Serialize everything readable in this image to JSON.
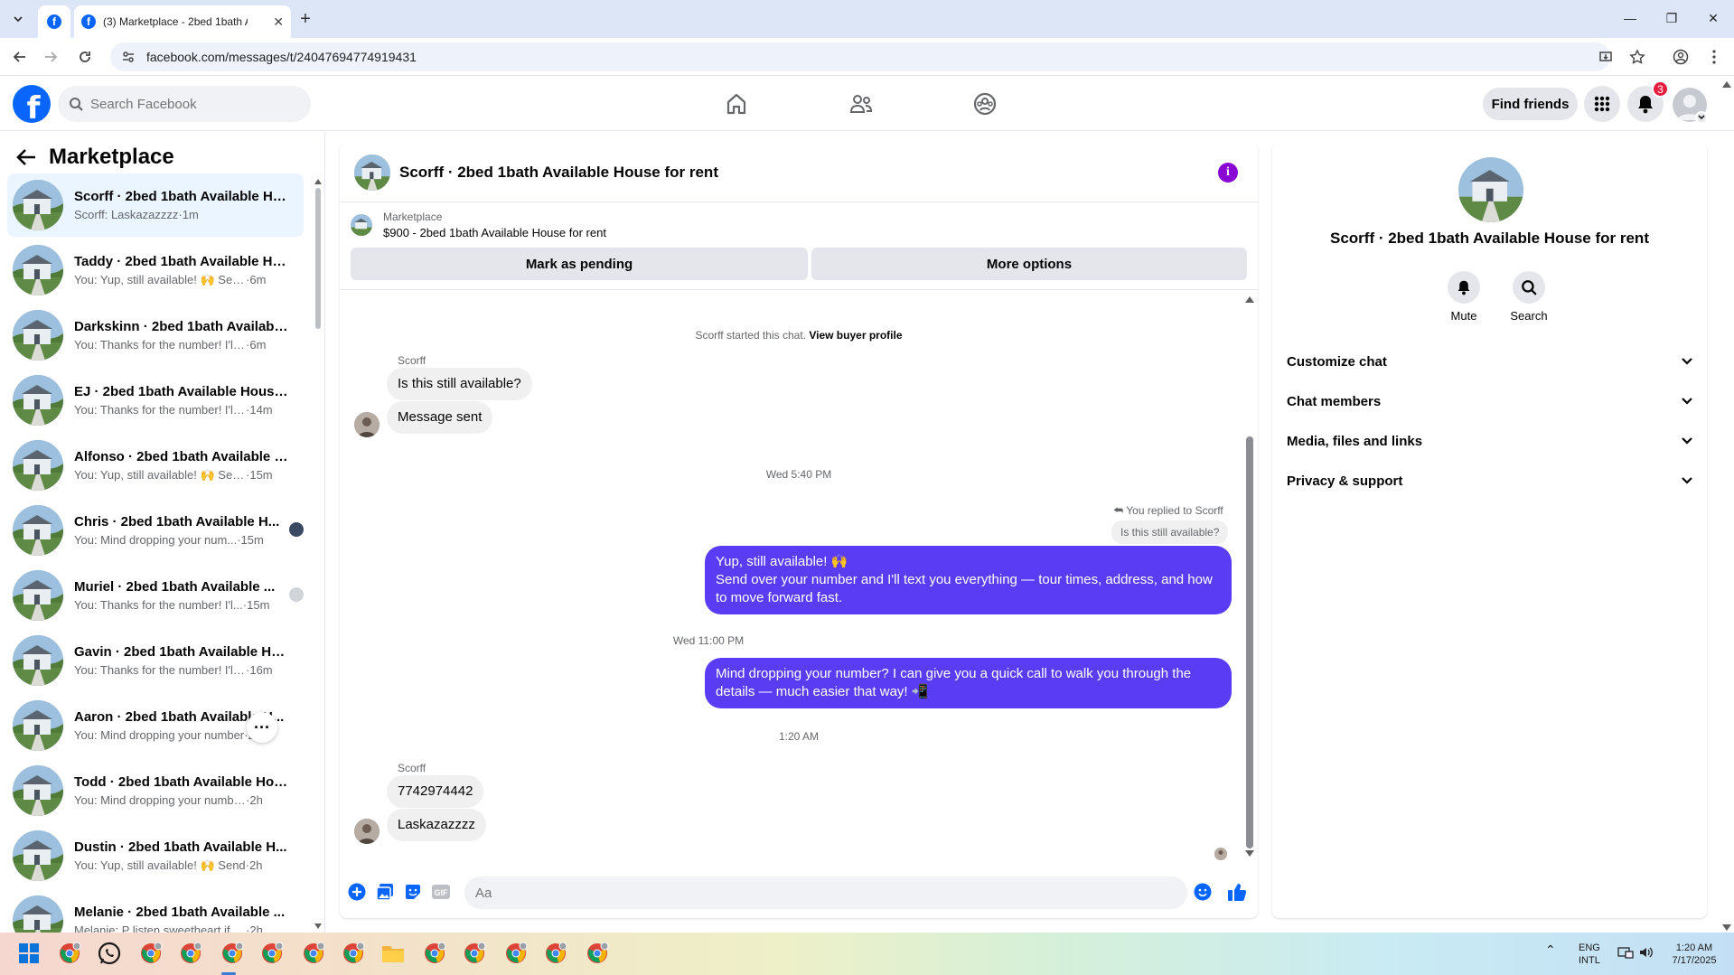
{
  "browser": {
    "tab_title": "(3) Marketplace - 2bed 1bath A",
    "url": "facebook.com/messages/t/24047694774919431"
  },
  "header": {
    "search_placeholder": "Search Facebook",
    "find_friends": "Find friends",
    "notifications_count": "3"
  },
  "sidebar": {
    "title": "Marketplace",
    "conversations": [
      {
        "name": "Scorff · 2bed 1bath Available Ho...",
        "preview": "Scorff: Laskazazzzz",
        "time": "1m"
      },
      {
        "name": "Taddy · 2bed 1bath Available Ho...",
        "preview": "You: Yup, still available! 🙌 Send o...",
        "time": "6m"
      },
      {
        "name": "Darkskinn · 2bed 1bath Available...",
        "preview": "You: Thanks for the number! I'll me...",
        "time": "6m"
      },
      {
        "name": "EJ · 2bed 1bath Available House ...",
        "preview": "You: Thanks for the number! I'll m...",
        "time": "14m"
      },
      {
        "name": "Alfonso · 2bed 1bath Available H...",
        "preview": "You: Yup, still available! 🙌 Send ...",
        "time": "15m"
      },
      {
        "name": "Chris · 2bed 1bath Available H...",
        "preview": "You: Mind dropping your num...",
        "time": "15m"
      },
      {
        "name": "Muriel · 2bed 1bath Available ...",
        "preview": "You: Thanks for the number! I'l...",
        "time": "15m"
      },
      {
        "name": "Gavin · 2bed 1bath Available Ho...",
        "preview": "You: Thanks for the number! I'll m...",
        "time": "16m"
      },
      {
        "name": "Aaron · 2bed 1bath Available H...",
        "preview": "You: Mind dropping your number",
        "time": "2h"
      },
      {
        "name": "Todd · 2bed 1bath Available Hou...",
        "preview": "You: Mind dropping your number? ...",
        "time": "2h"
      },
      {
        "name": "Dustin · 2bed 1bath Available H...",
        "preview": "You: Yup, still available! 🙌 Send",
        "time": "2h"
      },
      {
        "name": "Melanie · 2bed 1bath Available ...",
        "preview": "Melanie: P listen sweetheart if this i...",
        "time": "2h"
      }
    ]
  },
  "chat": {
    "title": "Scorff · 2bed 1bath Available House for rent",
    "marketplace_label": "Marketplace",
    "listing": "$900 - 2bed 1bath Available House for rent",
    "mark_pending": "Mark as pending",
    "more_options": "More options",
    "started_text": "Scorff started this chat.",
    "view_profile": "View buyer profile",
    "sender_name": "Scorff",
    "msg1": "Is this still available?",
    "msg2": "Message sent",
    "time1": "Wed 5:40 PM",
    "replied_label": "You replied to Scorff",
    "reply_quote": "Is this still available?",
    "my_msg1": "Yup, still available! 🙌\nSend over your number and I'll text you everything — tour times, address, and how to move forward fast.",
    "time2": "Wed 11:00 PM",
    "my_msg2": "Mind dropping your number? I can give you a quick call to walk you through the details — much easier that way! 📲",
    "time3": "1:20 AM",
    "sender_name2": "Scorff",
    "msg3": "7742974442",
    "msg4": "Laskazazzzz",
    "composer_placeholder": "Aa"
  },
  "right_panel": {
    "title": "Scorff · 2bed 1bath Available House for rent",
    "mute": "Mute",
    "search": "Search",
    "sections": [
      "Customize chat",
      "Chat members",
      "Media, files and links",
      "Privacy & support"
    ]
  },
  "taskbar": {
    "lang1": "ENG",
    "lang2": "INTL",
    "time": "1:20 AM",
    "date": "7/17/2025"
  },
  "colors": {
    "brand": "#0866ff",
    "my_bubble": "#5b3cf5",
    "info": "#8a08d4",
    "badge": "#e41e3f"
  }
}
